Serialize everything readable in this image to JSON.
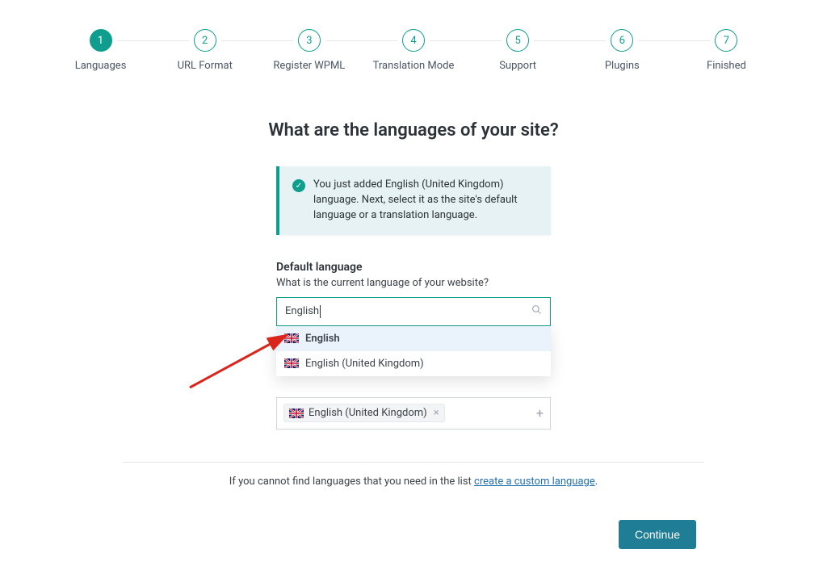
{
  "stepper": {
    "steps": [
      {
        "num": "1",
        "label": "Languages",
        "active": true
      },
      {
        "num": "2",
        "label": "URL Format",
        "active": false
      },
      {
        "num": "3",
        "label": "Register WPML",
        "active": false
      },
      {
        "num": "4",
        "label": "Translation Mode",
        "active": false
      },
      {
        "num": "5",
        "label": "Support",
        "active": false
      },
      {
        "num": "6",
        "label": "Plugins",
        "active": false
      },
      {
        "num": "7",
        "label": "Finished",
        "active": false
      }
    ]
  },
  "heading": "What are the languages of your site?",
  "notice_text": "You just added English (United Kingdom) language. Next, select it as the site's default language or a translation language.",
  "default_lang": {
    "title": "Default language",
    "subtitle": "What is the current language of your website?",
    "input_value": "English"
  },
  "dropdown": {
    "items": [
      {
        "label": "English",
        "highlight": true
      },
      {
        "label": "English (United Kingdom)",
        "highlight": false
      }
    ]
  },
  "translation_tag": {
    "label": "English (United Kingdom)"
  },
  "footnote": {
    "prefix": "If you cannot find languages that you need in the list ",
    "link": "create a custom language",
    "suffix": "."
  },
  "continue_label": "Continue"
}
